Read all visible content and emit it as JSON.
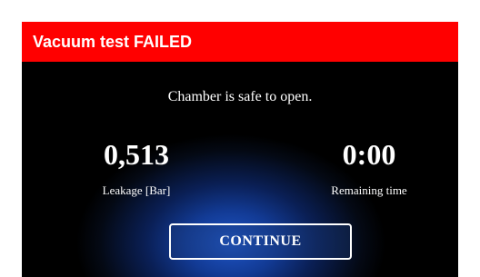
{
  "dialog": {
    "title": "Vacuum test FAILED",
    "message": "Chamber is safe to open.",
    "leakage": {
      "value": "0,513",
      "label": "Leakage [Bar]"
    },
    "remaining": {
      "value": "0:00",
      "label": "Remaining time"
    },
    "continue_label": "CONTINUE"
  },
  "colors": {
    "title_bar": "#ff0000",
    "background": "#000000",
    "glow": "#1f56c8",
    "text": "#ffffff"
  }
}
